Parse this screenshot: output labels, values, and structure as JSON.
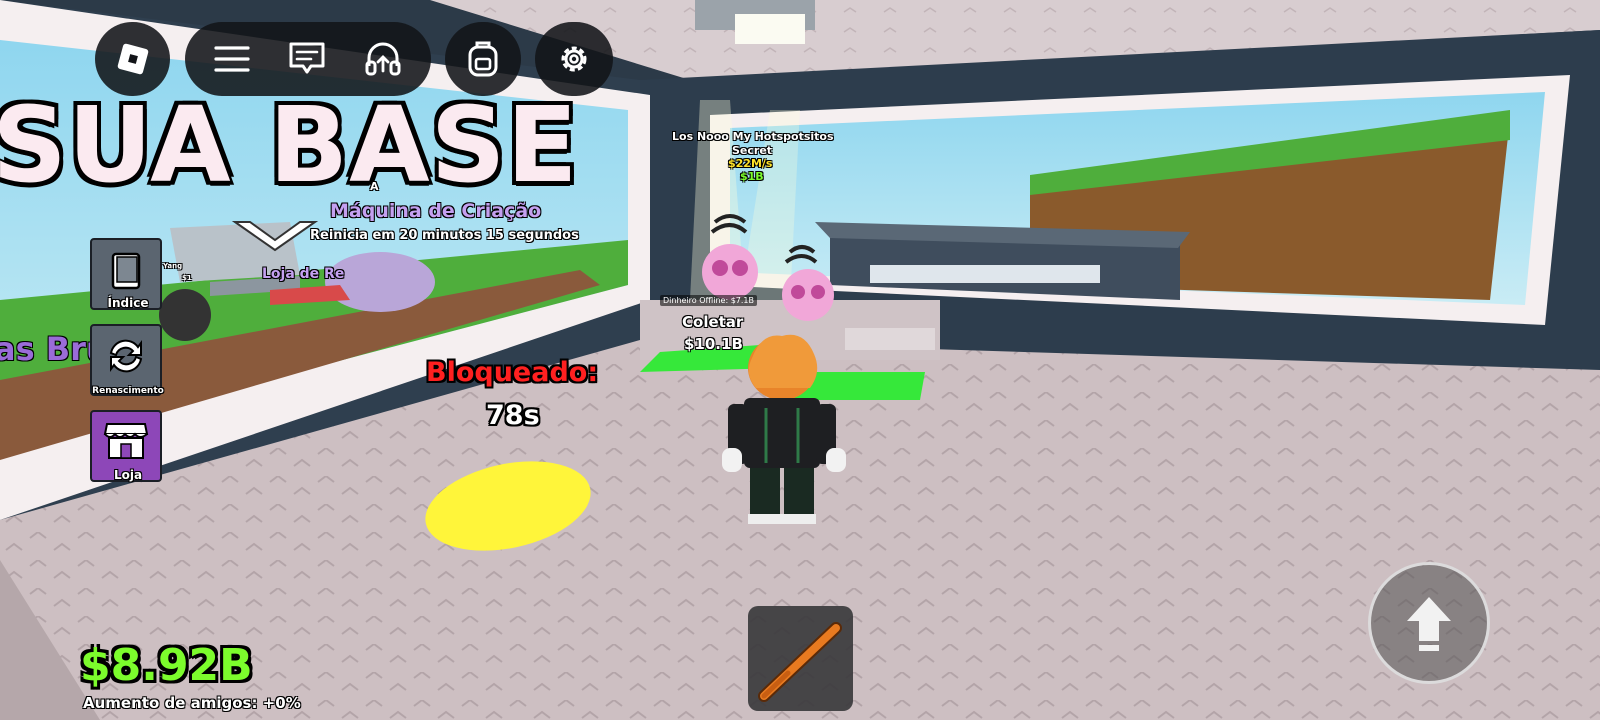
{
  "top_bar": {
    "menu_icon": "roblox-logo-icon",
    "hamburger_icon": "hamburger-menu-icon",
    "chat_icon": "chat-icon",
    "voice_icon": "headphones-icon",
    "backpack_icon": "backpack-icon",
    "settings_icon": "gear-icon"
  },
  "world": {
    "base_sign": "SUA BASE",
    "machine_title": "Máquina de Criação",
    "machine_subtitle": "Reinicia em 20 minutos 15 segundos",
    "machine_top": "A",
    "shop_sign": "Loja de Re",
    "left_board": "as Bru",
    "small_sign_1": "Yang",
    "small_sign_2": "$1",
    "brainrot_name": "Los Nooo My Hotspotsitos",
    "brainrot_rarity": "Secret",
    "brainrot_rate": "$22M/s",
    "brainrot_price": "$1B",
    "offline_money": "Dinheiro Offline: $7.1B",
    "collect_label": "Coletar",
    "collect_value": "$10.1B",
    "locked_label": "Bloqueado:",
    "locked_timer": "78s"
  },
  "side_menu": [
    {
      "label": "Índice",
      "icon": "book-icon"
    },
    {
      "label": "Renascimento",
      "icon": "rebirth-icon"
    },
    {
      "label": "Loja",
      "icon": "shop-icon"
    }
  ],
  "hud": {
    "money": "$8.92B",
    "friend_boost": "Aumento de amigos: +0%"
  },
  "hotbar": {
    "slot_1_icon": "baseball-bat-icon"
  },
  "jump_button": {
    "icon": "up-arrow-icon"
  },
  "colors": {
    "money_green": "#7cfc2c",
    "locked_red": "#ff2020",
    "pad_yellow": "#fff53a",
    "pad_green": "#36e83a",
    "brainrot_name_purple": "#c8a0ff"
  }
}
